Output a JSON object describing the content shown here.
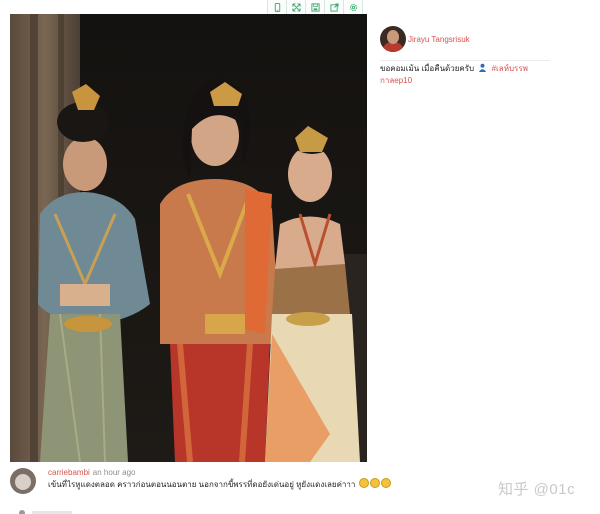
{
  "toolbar": {
    "buttons": [
      {
        "icon": "mobile-view-icon"
      },
      {
        "icon": "fullscreen-icon"
      },
      {
        "icon": "save-icon"
      },
      {
        "icon": "share-icon"
      },
      {
        "icon": "settings-icon"
      }
    ],
    "accent": "#39a66b"
  },
  "post": {
    "image_alt": "",
    "author": {
      "name": "Jirayu Tangsrisuk",
      "name_color": "#d9534f"
    },
    "caption": {
      "text": "ขอคอมเม้น เมื่อคืนด้วยครับ",
      "emoji": "person-emoji",
      "hashtag": "#เลห์บรรพ",
      "hashtag2": "กาลep10"
    }
  },
  "comment": {
    "username": "carriebambi",
    "time": "an hour ago",
    "text": "เข้นที่ไรหูแดงตลอด คราวก่อนตอนนอนตาย นอกจากขี้พรรที่ดอยังเด่นอยู่ หูยังแดงเลยค่าาา",
    "emojis": [
      "rofl-emoji",
      "rofl-emoji",
      "rofl-emoji"
    ]
  },
  "watermark": "知乎 @01c"
}
